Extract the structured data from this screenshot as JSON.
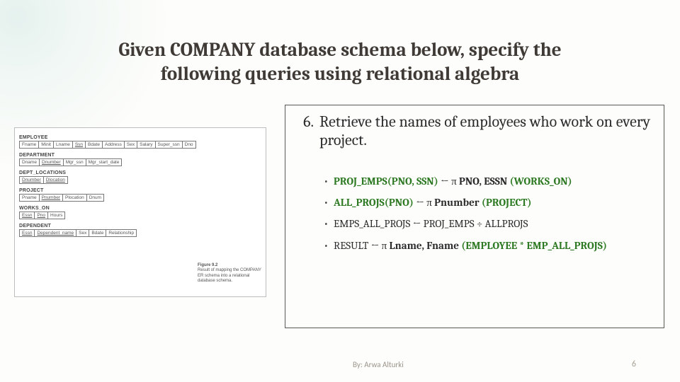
{
  "title_line1": "Given COMPANY database schema below, specify the",
  "title_line2": "following queries using relational algebra",
  "schema": {
    "employee_label": "EMPLOYEE",
    "employee_cols": [
      "Fname",
      "Minit",
      "Lname",
      "Ssn",
      "Bdate",
      "Address",
      "Sex",
      "Salary",
      "Super_ssn",
      "Dno"
    ],
    "department_label": "DEPARTMENT",
    "department_cols": [
      "Dname",
      "Dnumber",
      "Mgr_ssn",
      "Mgr_start_date"
    ],
    "dept_loc_label": "DEPT_LOCATIONS",
    "dept_loc_cols": [
      "Dnumber",
      "Dlocation"
    ],
    "project_label": "PROJECT",
    "project_cols": [
      "Pname",
      "Pnumber",
      "Plocation",
      "Dnum"
    ],
    "works_on_label": "WORKS_ON",
    "works_on_cols": [
      "Essn",
      "Pno",
      "Hours"
    ],
    "dependent_label": "DEPENDENT",
    "dependent_cols": [
      "Essn",
      "Dependent_name",
      "Sex",
      "Bdate",
      "Relationship"
    ],
    "figure_title": "Figure 9.2",
    "figure_caption": "Result of mapping the COMPANY ER schema into a relational database schema."
  },
  "question": {
    "number": "6.",
    "text": "Retrieve the names of employees who work on every project."
  },
  "ra": {
    "l1_a": "PROJ_EMPS(PNO, SSN)",
    "l1_b": " ← π ",
    "l1_c": "PNO, ESSN ",
    "l1_d": "(WORKS_ON)",
    "l2_a": "ALL_PROJS(PNO)",
    "l2_b": " ← π ",
    "l2_c": "Pnumber ",
    "l2_d": "(PROJECT)",
    "l3": "EMPS_ALL_PROJS ← PROJ_EMPS ÷ ALLPROJS",
    "l4_a": "RESULT ← π ",
    "l4_b": "Lname, Fname ",
    "l4_c": "(EMPLOYEE * EMP_ALL_PROJS)"
  },
  "footer": {
    "author": "By: Arwa Alturki",
    "page": "6"
  }
}
